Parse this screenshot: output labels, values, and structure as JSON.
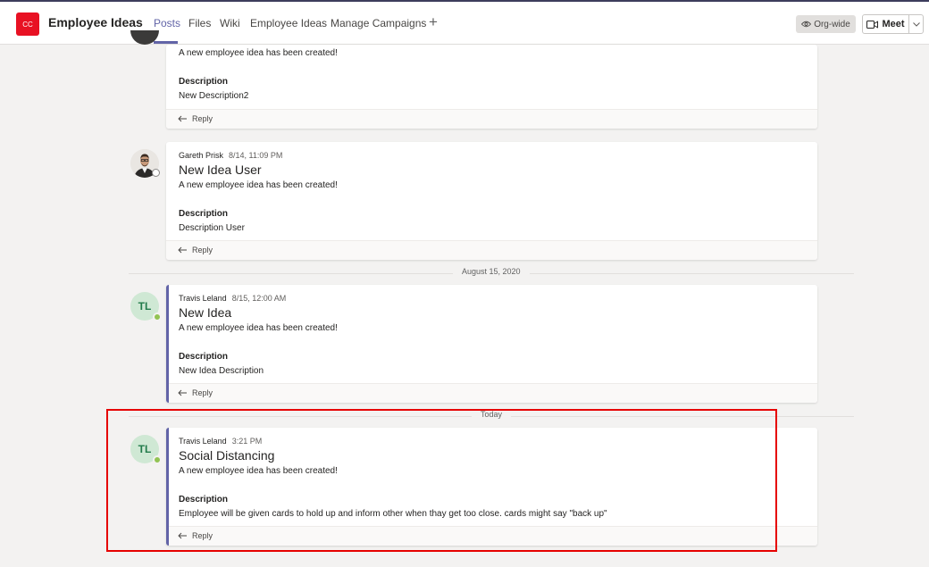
{
  "header": {
    "app_badge": "CC",
    "title": "Employee Ideas",
    "tabs": [
      {
        "label": "Posts"
      },
      {
        "label": "Files"
      },
      {
        "label": "Wiki"
      },
      {
        "label": "Employee Ideas"
      },
      {
        "label": "Manage Campaigns"
      }
    ],
    "add_tab_icon": "+",
    "org_wide": "Org-wide",
    "meet": "Meet"
  },
  "posts": [
    {
      "body": "A new employee idea has been created!",
      "description_label": "Description",
      "description": "New Description2",
      "reply": "Reply"
    },
    {
      "author": "Gareth Prisk",
      "time": "8/14, 11:09 PM",
      "title": "New Idea User",
      "body": "A new employee idea has been created!",
      "description_label": "Description",
      "description": "Description User",
      "reply": "Reply"
    },
    {
      "author": "Travis Leland",
      "initials": "TL",
      "time": "8/15, 12:00 AM",
      "title": "New Idea",
      "body": "A new employee idea has been created!",
      "description_label": "Description",
      "description": "New Idea Description",
      "reply": "Reply"
    },
    {
      "author": "Travis Leland",
      "initials": "TL",
      "time": "3:21 PM",
      "title": "Social Distancing",
      "body": "A new employee idea has been created!",
      "description_label": "Description",
      "description": "Employee will be given cards to hold up and inform other when thay get too close. cards might say \"back up\"",
      "reply": "Reply"
    }
  ],
  "dividers": {
    "date1": "August 15, 2020",
    "date2": "Today"
  },
  "colors": {
    "accent": "#6264a7",
    "badge": "#e81123",
    "presence": "#92c353",
    "highlight": "#e60000"
  }
}
